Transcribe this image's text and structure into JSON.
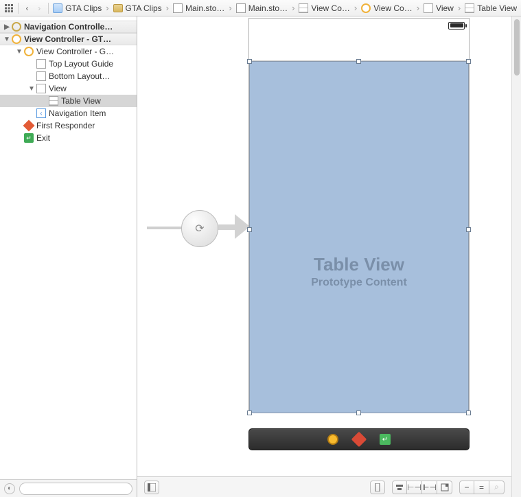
{
  "topbar": {
    "app_icon_tooltip": "Related Items",
    "breadcrumbs": [
      {
        "kind": "doc",
        "label": "GTA Clips"
      },
      {
        "kind": "folder",
        "label": "GTA Clips"
      },
      {
        "kind": "sb",
        "label": "Main.sto…"
      },
      {
        "kind": "sb",
        "label": "Main.sto…"
      },
      {
        "kind": "sb-gray",
        "label": "View Co…"
      },
      {
        "kind": "vc",
        "label": "View Co…"
      },
      {
        "kind": "view",
        "label": "View"
      },
      {
        "kind": "tv",
        "label": "Table View"
      }
    ]
  },
  "outline": {
    "scenes": [
      {
        "label": "Navigation Controlle…",
        "expanded": true,
        "icon": "scene"
      },
      {
        "label": "View Controller - GT…",
        "expanded": true,
        "icon": "scene",
        "children": [
          {
            "label": "View Controller - G…",
            "icon": "vc",
            "expanded": true,
            "children": [
              {
                "label": "Top Layout Guide",
                "icon": "view"
              },
              {
                "label": "Bottom Layout…",
                "icon": "view"
              },
              {
                "label": "View",
                "icon": "view",
                "expanded": true,
                "children": [
                  {
                    "label": "Table View",
                    "icon": "tv",
                    "selected": true
                  }
                ]
              },
              {
                "label": "Navigation Item",
                "icon": "ni"
              }
            ]
          },
          {
            "label": "First Responder",
            "icon": "fr"
          },
          {
            "label": "Exit",
            "icon": "exit"
          }
        ]
      }
    ],
    "filter_placeholder": ""
  },
  "canvas": {
    "table_view_title": "Table View",
    "table_view_subtitle": "Prototype Content"
  },
  "colors": {
    "tableview_bg": "#a7bfdc"
  }
}
